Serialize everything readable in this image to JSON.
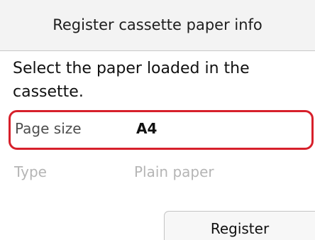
{
  "header": {
    "title": "Register cassette paper info"
  },
  "instruction": "Select the paper loaded in the cassette.",
  "settings": [
    {
      "label": "Page size",
      "value": "A4",
      "selected": true
    },
    {
      "label": "Type",
      "value": "Plain paper",
      "selected": false
    }
  ],
  "actions": {
    "register_label": "Register"
  },
  "colors": {
    "selection_border": "#d7202b",
    "disabled_text": "#b5b5b5"
  }
}
